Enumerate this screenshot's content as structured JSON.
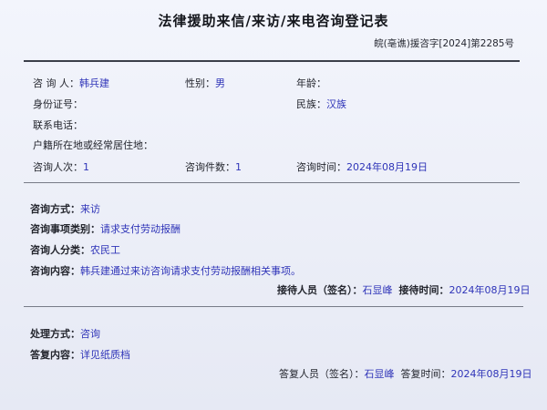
{
  "header": {
    "title": "法律援助来信/来访/来电咨询登记表",
    "doc_number": "皖(亳谯)援咨字[2024]第2285号"
  },
  "info": {
    "consultant_label": "咨 询 人：",
    "consultant_value": "韩兵建",
    "gender_label": "性别：",
    "gender_value": "男",
    "age_label": "年龄：",
    "age_value": "",
    "id_label": "身份证号：",
    "id_value": "",
    "ethnicity_label": "民族：",
    "ethnicity_value": "汉族",
    "phone_label": "联系电话：",
    "phone_value": "",
    "address_label": "户籍所在地或经常居住地：",
    "address_value": "",
    "count_label": "咨询人次：",
    "count_value": "1",
    "cases_label": "咨询件数：",
    "cases_value": "1",
    "time_label": "咨询时间：",
    "time_value": "2024年08月19日"
  },
  "consultation": {
    "method_label": "咨询方式：",
    "method_value": "来访",
    "category_label": "咨询事项类别：",
    "category_value": "请求支付劳动报酬",
    "person_type_label": "咨询人分类：",
    "person_type_value": "农民工",
    "content_label": "咨询内容：",
    "content_value": "韩兵建通过来访咨询请求支付劳动报酬相关事项。",
    "receiver_label": "接待人员（签名）：",
    "receiver_value": "石显峰",
    "receive_time_label": "接待时间：",
    "receive_time_value": "2024年08月19日"
  },
  "handling": {
    "method_label": "处理方式：",
    "method_value": "咨询",
    "reply_label": "答复内容：",
    "reply_value": "详见纸质档",
    "replier_label": "答复人员（签名）：",
    "replier_value": "石显峰",
    "reply_time_label": "答复时间：",
    "reply_time_value": "2024年08月19日"
  },
  "colors": {
    "value_text": "#2f34b8",
    "label_text": "#23252d",
    "paper": "#eef0f8"
  }
}
